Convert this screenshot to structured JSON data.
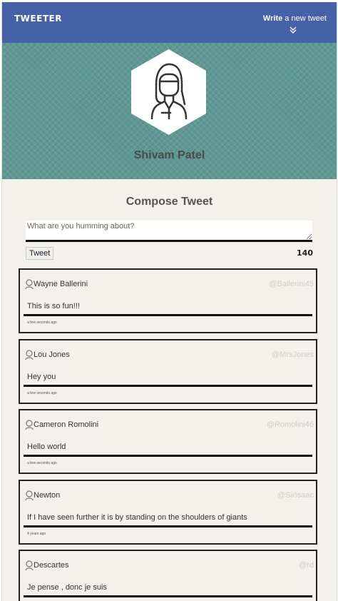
{
  "navbar": {
    "brand": "TWEETER",
    "write_bold": "Write",
    "write_rest": " a new tweet"
  },
  "profile": {
    "name": "Shivam Patel"
  },
  "compose": {
    "title": "Compose Tweet",
    "placeholder": "What are you humming about?",
    "button_label": "Tweet",
    "chars_remaining": "140"
  },
  "tweets": [
    {
      "name": "Wayne Ballerini",
      "handle": "@Ballerini45",
      "text": "This is so fun!!!",
      "time": "a few seconds ago"
    },
    {
      "name": "Lou Jones",
      "handle": "@MrsJones",
      "text": "Hey you",
      "time": "a few seconds ago"
    },
    {
      "name": "Cameron Romolini",
      "handle": "@Romolini46",
      "text": "Hello world",
      "time": "a few seconds ago"
    },
    {
      "name": "Newton",
      "handle": "@SirIsaac",
      "text": "If I have seen further it is by standing on the shoulders of giants",
      "time": "4 years ago"
    },
    {
      "name": "Descartes",
      "handle": "@rd",
      "text": "Je pense , donc je suis",
      "time": ""
    }
  ],
  "colors": {
    "navbar": "#4561a7",
    "hero": "#5e9894",
    "page_bg": "#f4f1ed"
  },
  "icons": {
    "nav_chevron": "double-chevron-down-icon",
    "profile_avatar": "person-avatar-icon",
    "tweet_avatar": "user-avatar-icon"
  }
}
